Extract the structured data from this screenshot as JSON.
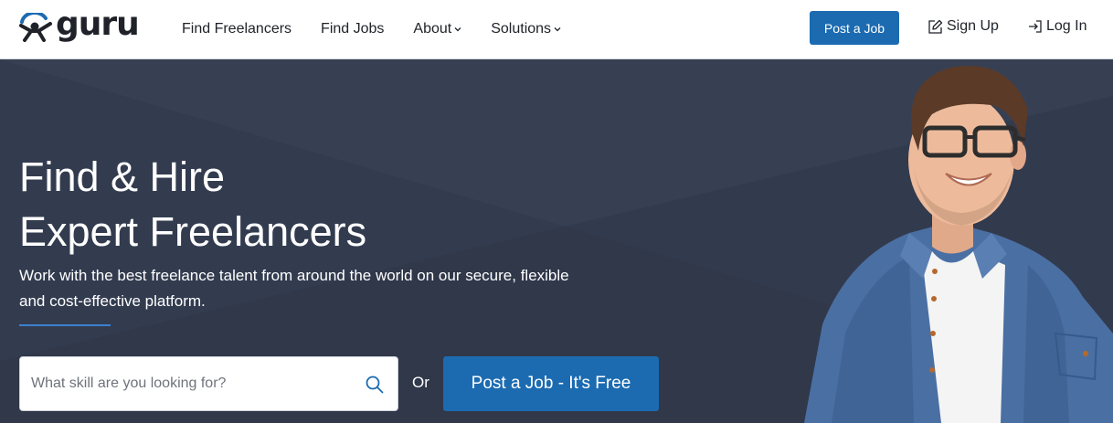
{
  "header": {
    "logo_text": "guru",
    "nav": [
      {
        "label": "Find Freelancers",
        "has_dropdown": false
      },
      {
        "label": "Find Jobs",
        "has_dropdown": false
      },
      {
        "label": "About",
        "has_dropdown": true
      },
      {
        "label": "Solutions",
        "has_dropdown": true
      }
    ],
    "post_job_label": "Post a Job",
    "signup_label": "Sign Up",
    "login_label": "Log In"
  },
  "hero": {
    "title_line1": "Find & Hire",
    "title_line2": "Expert Freelancers",
    "subtitle": "Work with the best freelance talent from around the world on our secure, flexible and cost-effective platform.",
    "search": {
      "placeholder": "What skill are you looking for?",
      "value": ""
    },
    "or_label": "Or",
    "post_job_label": "Post a Job - It's Free"
  },
  "icons": {
    "logo": "guru-logo-icon",
    "search": "search-icon",
    "signup": "edit-icon",
    "login": "login-icon",
    "dropdown": "chevron-down-icon"
  },
  "colors": {
    "brand_blue": "#1c6bb1",
    "hero_bg": "#333c4f",
    "accent_rule": "#3d7fd1",
    "text_dark": "#1f2229"
  }
}
